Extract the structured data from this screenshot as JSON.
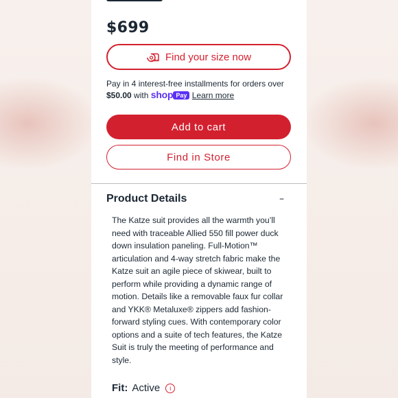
{
  "product": {
    "price": "$699"
  },
  "size_button": {
    "label": "Find your size now",
    "icon": "measuring-tape-icon"
  },
  "installments": {
    "text": "Pay in 4 interest-free installments for orders over",
    "amount": "$50.00",
    "with": "with",
    "shop_logo": "shop",
    "pay_badge": "Pay",
    "learn_more": "Learn more"
  },
  "buttons": {
    "add_to_cart": "Add to cart",
    "find_in_store": "Find in Store"
  },
  "details": {
    "title": "Product Details",
    "toggle_symbol": "–",
    "description": "The Katze suit provides all the warmth you’ll need with traceable Allied 550 fill power duck down insulation paneling. Full-Motion™ articulation and 4-way stretch fabric make the Katze suit an agile piece of skiwear, built to perform while providing a dynamic range of motion. Details like a removable faux fur collar and YKK® Metaluxe® zippers add fashion-forward styling cues. With contemporary color options and a suite of tech features, the Katze Suit is truly the meeting of performance and style."
  },
  "fit": {
    "label": "Fit:",
    "value": "Active",
    "info_symbol": "i"
  },
  "colors": {
    "accent": "#d3202f",
    "text": "#1b2733",
    "shop_purple": "#5a31f4"
  }
}
